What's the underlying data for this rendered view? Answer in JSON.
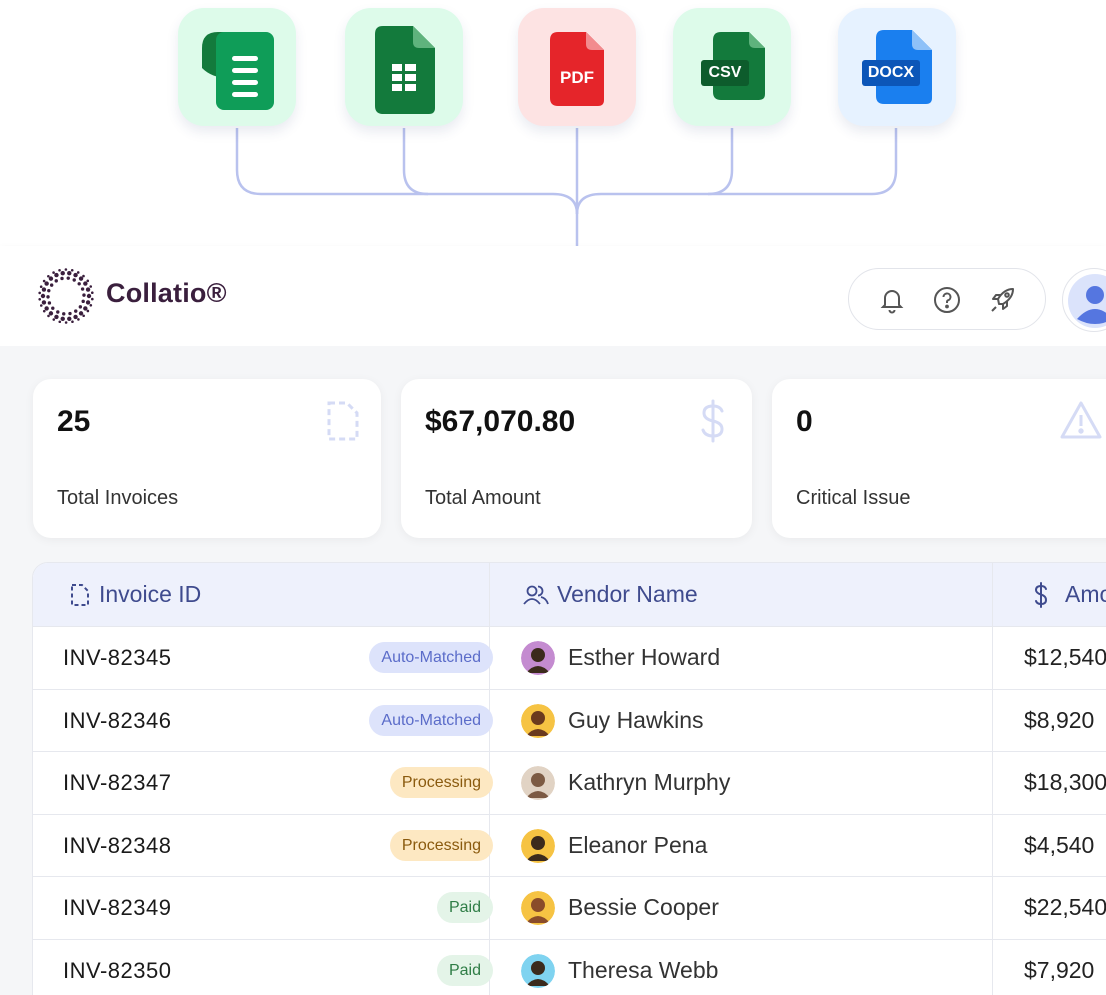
{
  "file_types": [
    {
      "name": "google-forms",
      "label": "",
      "bg": "#ddfbea"
    },
    {
      "name": "google-sheets",
      "label": "",
      "bg": "#ddfbea"
    },
    {
      "name": "pdf",
      "label": "PDF",
      "bg": "#fde3e3"
    },
    {
      "name": "csv",
      "label": "CSV",
      "bg": "#ddfbea"
    },
    {
      "name": "docx",
      "label": "DOCX",
      "bg": "#e6f2ff"
    }
  ],
  "header": {
    "brand": "Collatio®",
    "actions": [
      "bell-icon",
      "help-icon",
      "rocket-icon"
    ]
  },
  "stats": [
    {
      "value": "25",
      "label": "Total Invoices",
      "icon": "invoice-icon"
    },
    {
      "value": "$67,070.80",
      "label": "Total Amount",
      "icon": "dollar-icon"
    },
    {
      "value": "0",
      "label": "Critical Issue",
      "icon": "warning-icon"
    }
  ],
  "table": {
    "headers": {
      "invoice_id": "Invoice ID",
      "vendor_name": "Vendor Name",
      "amount": "Amo"
    },
    "rows": [
      {
        "id": "INV-82345",
        "status": "Auto-Matched",
        "vendor": "Esther Howard",
        "amount": "$12,540"
      },
      {
        "id": "INV-82346",
        "status": "Auto-Matched",
        "vendor": "Guy Hawkins",
        "amount": "$8,920"
      },
      {
        "id": "INV-82347",
        "status": "Processing",
        "vendor": "Kathryn Murphy",
        "amount": "$18,300"
      },
      {
        "id": "INV-82348",
        "status": "Processing",
        "vendor": "Eleanor Pena",
        "amount": "$4,540"
      },
      {
        "id": "INV-82349",
        "status": "Paid",
        "vendor": "Bessie Cooper",
        "amount": "$22,540"
      },
      {
        "id": "INV-82350",
        "status": "Paid",
        "vendor": "Theresa Webb",
        "amount": "$7,920"
      }
    ]
  },
  "colors": {
    "accent": "#3f4b8e",
    "brand": "#3a1f3d",
    "connector": "#b9c2ee"
  }
}
